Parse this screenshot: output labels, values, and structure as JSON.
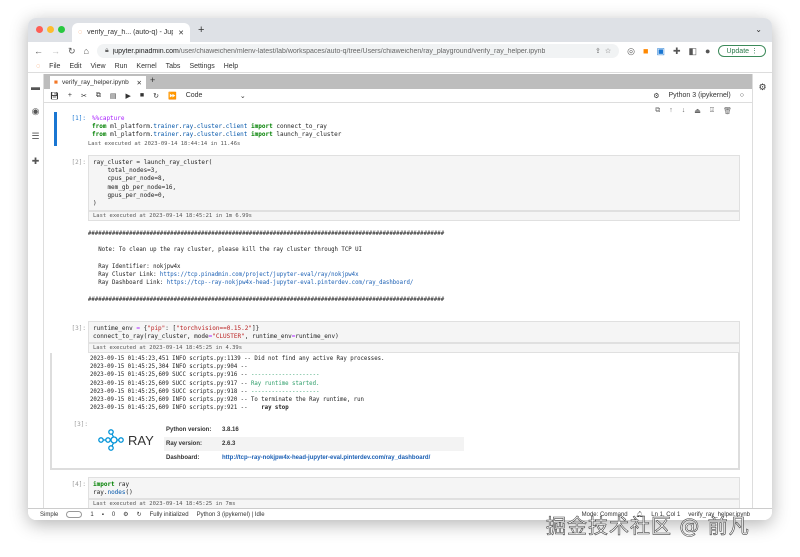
{
  "browser": {
    "tab_title": "verify_ray_h... (auto-q) - Jupyt",
    "url_host": "jupyter.pinadmin.com",
    "url_path": "/user/chiaweichen/mlenv-latest/lab/workspaces/auto-q/tree/Users/chiaweichen/ray_playground/verify_ray_helper.ipynb",
    "update_label": "Update"
  },
  "menu": [
    "File",
    "Edit",
    "View",
    "Run",
    "Kernel",
    "Tabs",
    "Settings",
    "Help"
  ],
  "notebook": {
    "tab": "verify_ray_helper.ipynb",
    "cell_type": "Code",
    "kernel": "Python 3 (ipykernel)"
  },
  "cells": [
    {
      "prompt": "[1]:",
      "lines": [
        "%%capture",
        "from ml_platform.trainer.ray.cluster.client import connect_to_ray",
        "from ml_platform.trainer.ray.cluster.client import launch_ray_cluster"
      ],
      "meta": "Last executed at 2023-09-14 18:44:14 in 11.46s"
    },
    {
      "prompt": "[2]:",
      "lines": [
        "ray_cluster = launch_ray_cluster(",
        "    total_nodes=3,",
        "    cpus_per_node=8,",
        "    mem_gb_per_node=16,",
        "    gpus_per_node=0,",
        ")"
      ],
      "meta": "Last executed at 2023-09-14 18:45:21 in 1m 6.99s",
      "output": {
        "hashes": "########################################################################################################",
        "note": "Note: To clean up the ray cluster, please kill the ray cluster through TCP UI",
        "identifier": "Ray Identifier: nokjpw4x",
        "cluster_label": "Ray Cluster Link: ",
        "cluster_link": "https://tcp.pinadmin.com/project/jupyter-eval/ray/nokjpw4x",
        "dash_label": "Ray Dashboard Link: ",
        "dash_link": "https://tcp--ray-nokjpw4x-head-jupyter-eval.pinterdev.com/ray_dashboard/"
      }
    },
    {
      "prompt": "[3]:",
      "lines": [
        "runtime_env = {\"pip\": [\"torchvision==0.15.2\"]}",
        "connect_to_ray(ray_cluster, mode=\"CLUSTER\", runtime_env=runtime_env)"
      ],
      "meta": "Last executed at 2023-09-14 18:45:25 in 4.39s",
      "log": [
        "2023-09-15 01:45:23,451 INFO scripts.py:1139 -- Did not find any active Ray processes.",
        "2023-09-15 01:45:25,304 INFO scripts.py:904 --",
        "2023-09-15 01:45:25,609 SUCC scripts.py:916 -- ",
        "2023-09-15 01:45:25,609 SUCC scripts.py:917 -- ",
        "2023-09-15 01:45:25,609 SUCC scripts.py:918 -- ",
        "2023-09-15 01:45:25,609 INFO scripts.py:920 -- To terminate the Ray runtime, run",
        "2023-09-15 01:45:25,609 INFO scripts.py:921 --    "
      ],
      "log_green": [
        "--------------------",
        "Ray runtime started.",
        "--------------------"
      ],
      "ray_stop": "ray stop",
      "ray_logo": "RAY",
      "info": [
        {
          "k": "Python version:",
          "v": "3.8.16"
        },
        {
          "k": "Ray version:",
          "v": "2.6.3"
        },
        {
          "k": "Dashboard:",
          "v": "http://tcp--ray-nokjpw4x-head-jupyter-eval.pinterdev.com/ray_dashboard/"
        }
      ]
    },
    {
      "prompt": "[4]:",
      "lines": [
        "import ray",
        "ray.nodes()"
      ],
      "meta": "Last executed at 2023-09-14 18:45:25 in 7ms"
    }
  ],
  "status": {
    "mode_label": "Simple",
    "terminals": "1",
    "kernels": "0",
    "init": "Fully initialized",
    "kernel_state": "Python 3 (ipykernel) | Idle",
    "right": "Mode: Command",
    "cursor": "Ln 1, Col 1",
    "file": "verify_ray_helper.ipynb"
  },
  "watermark": "掘金技术社区 @ 前凡"
}
